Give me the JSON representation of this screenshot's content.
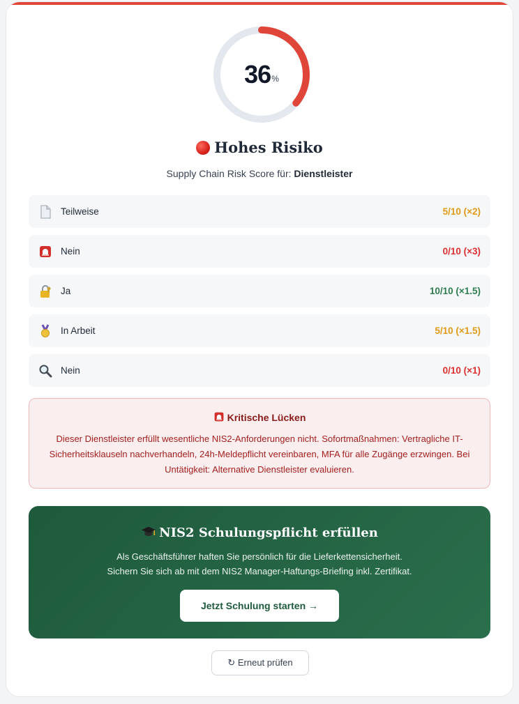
{
  "score": {
    "value": "36",
    "unit": "%",
    "fraction": 0.36,
    "ring_color": "#e0453a",
    "track_color": "#e3e7ee"
  },
  "risk": {
    "title": "Hohes Risiko",
    "icon": "red-circle-icon",
    "subtitle_prefix": "Supply Chain Risk Score für:",
    "subtitle_entity": "Dienstleister"
  },
  "rows": [
    {
      "icon": "document-icon",
      "label": "Teilweise",
      "score": "5/10 (×2)",
      "color": "amber"
    },
    {
      "icon": "siren-icon",
      "label": "Nein",
      "score": "0/10 (×3)",
      "color": "red"
    },
    {
      "icon": "lock-key-icon",
      "label": "Ja",
      "score": "10/10 (×1.5)",
      "color": "green"
    },
    {
      "icon": "medal-icon",
      "label": "In Arbeit",
      "score": "5/10 (×1.5)",
      "color": "amber"
    },
    {
      "icon": "magnifier-icon",
      "label": "Nein",
      "score": "0/10 (×1)",
      "color": "red"
    }
  ],
  "alert": {
    "title": "Kritische Lücken",
    "icon": "siren-icon",
    "line1": "Dieser Dienstleister erfüllt wesentliche NIS2-Anforderungen nicht. Sofortmaßnahmen: Vertragliche IT-",
    "line2": "Sicherheitsklauseln nachverhandeln, 24h-Meldepflicht vereinbaren, MFA für alle Zugänge erzwingen. Bei",
    "line3": "Untätigkeit: Alternative Dienstleister evaluieren."
  },
  "cta": {
    "icon": "graduation-cap-icon",
    "title": "NIS2 Schulungspflicht erfüllen",
    "line1": "Als Geschäftsführer haften Sie persönlich für die Lieferkettensicherheit.",
    "line2": "Sichern Sie sich ab mit dem NIS2 Manager-Haftungs-Briefing inkl. Zertifikat.",
    "button_label": "Jetzt Schulung starten →"
  },
  "retry": {
    "label": "↻ Erneut prüfen"
  },
  "colors": {
    "amber": "#e09b16",
    "red": "#dc2f2f",
    "green": "#2e7d4f",
    "accent_bar": "#e0453a"
  }
}
